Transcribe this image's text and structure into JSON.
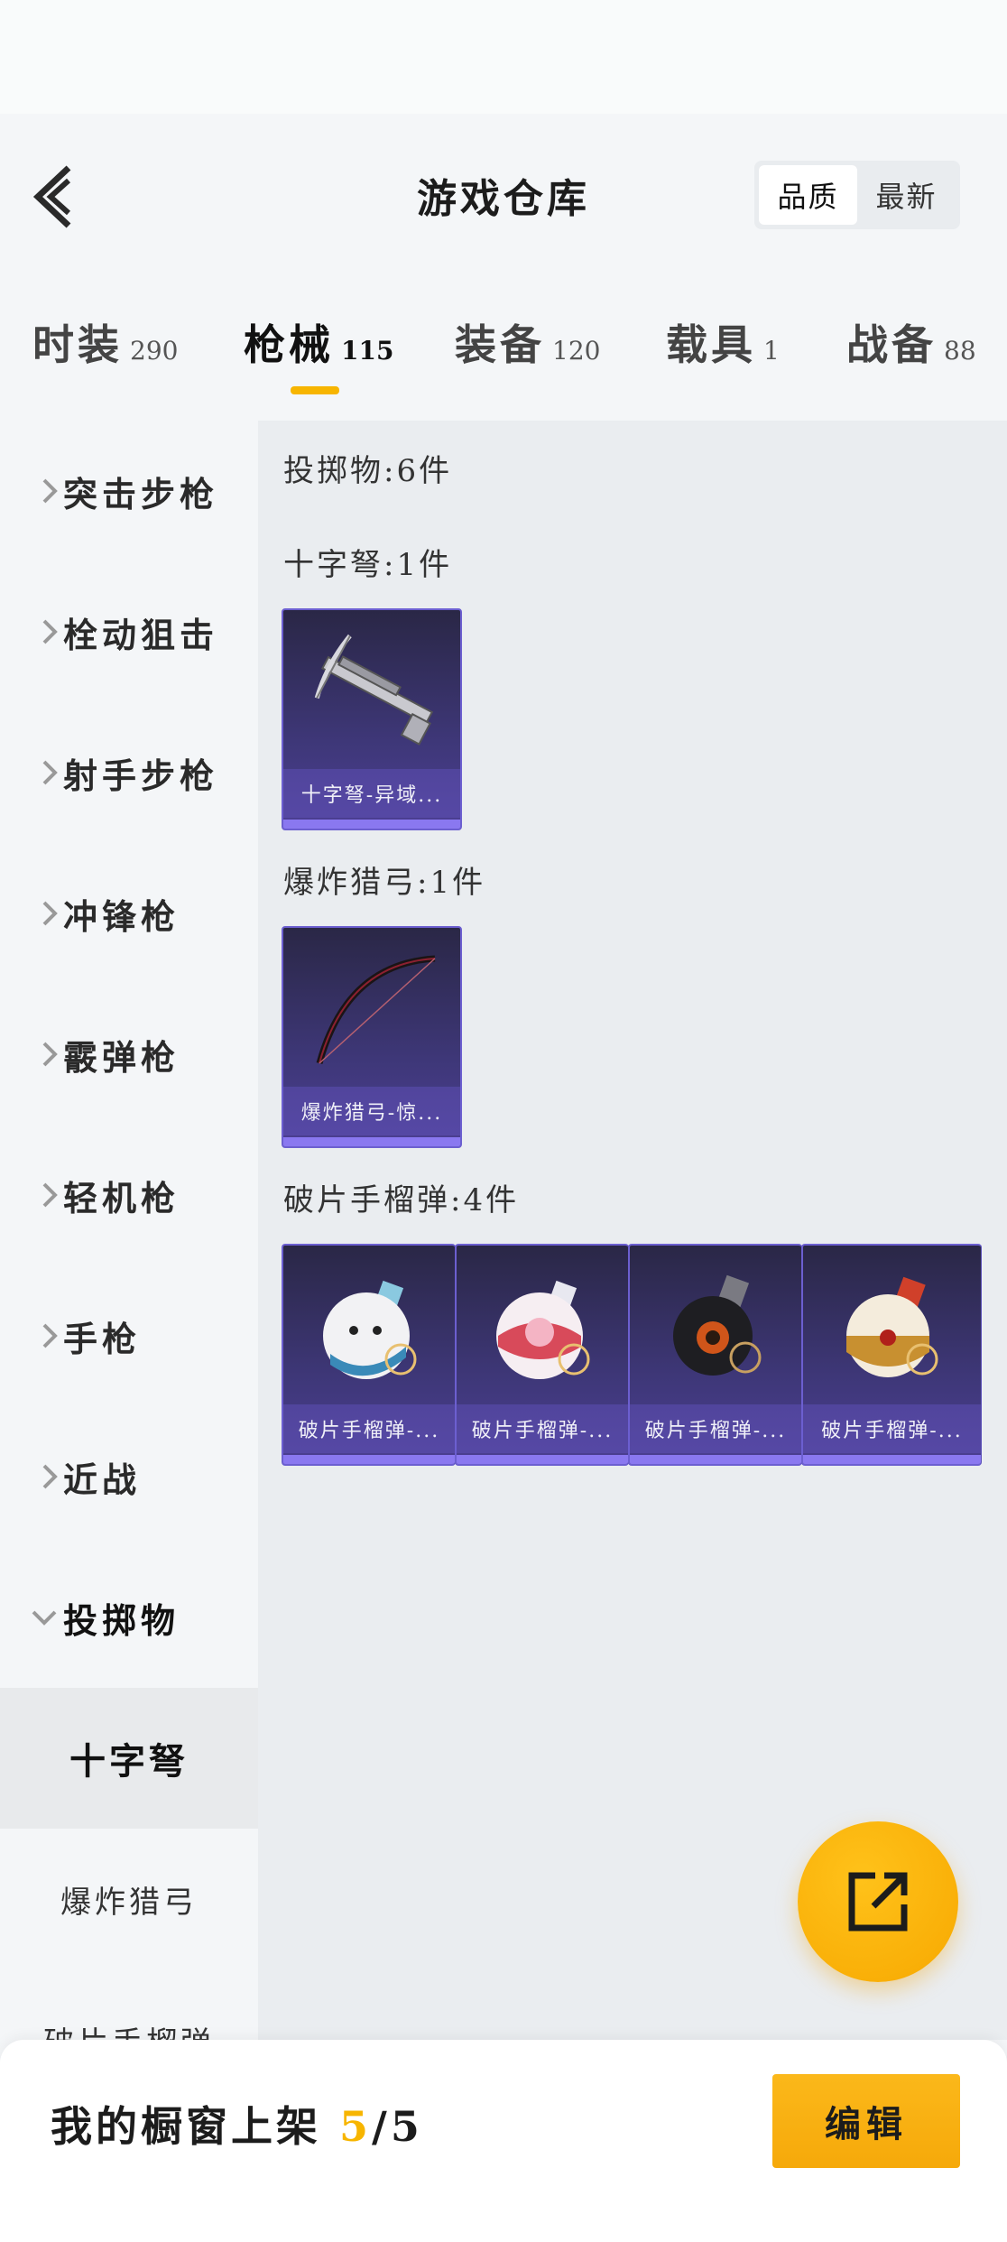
{
  "header": {
    "title": "游戏仓库",
    "sort_options": [
      "品质",
      "最新"
    ],
    "sort_active": "品质"
  },
  "tabs": [
    {
      "label": "时装",
      "count": "290"
    },
    {
      "label": "枪械",
      "count": "115",
      "active": true
    },
    {
      "label": "装备",
      "count": "120"
    },
    {
      "label": "载具",
      "count": "1"
    },
    {
      "label": "战备",
      "count": "88"
    }
  ],
  "sidebar": {
    "categories": [
      {
        "label": "突击步枪"
      },
      {
        "label": "栓动狙击"
      },
      {
        "label": "射手步枪"
      },
      {
        "label": "冲锋枪"
      },
      {
        "label": "霰弹枪"
      },
      {
        "label": "轻机枪"
      },
      {
        "label": "手枪"
      },
      {
        "label": "近战"
      },
      {
        "label": "投掷物",
        "expanded": true
      }
    ],
    "subcategories": [
      {
        "label": "十字弩",
        "active": true
      },
      {
        "label": "爆炸猎弓"
      },
      {
        "label": "破片手榴弹"
      }
    ]
  },
  "content": {
    "summary": "投掷物:6件",
    "sections": [
      {
        "title": "十字弩:1件",
        "items": [
          {
            "name": "十字弩-异域...",
            "icon": "crossbow-icon"
          }
        ]
      },
      {
        "title": "爆炸猎弓:1件",
        "items": [
          {
            "name": "爆炸猎弓-惊...",
            "icon": "bow-icon"
          }
        ]
      },
      {
        "title": "破片手榴弹:4件",
        "items": [
          {
            "name": "破片手榴弹-...",
            "icon": "grenade-white-icon"
          },
          {
            "name": "破片手榴弹-...",
            "icon": "grenade-pink-icon"
          },
          {
            "name": "破片手榴弹-...",
            "icon": "grenade-black-icon"
          },
          {
            "name": "破片手榴弹-...",
            "icon": "grenade-gold-icon"
          }
        ]
      }
    ]
  },
  "footer": {
    "prefix": "我的橱窗上架 ",
    "current": "5",
    "separator": "/",
    "total": "5",
    "edit_label": "编辑"
  },
  "colors": {
    "accent": "#f7b500",
    "card_bg": "#3e3778",
    "card_border": "#6c5fd0"
  }
}
